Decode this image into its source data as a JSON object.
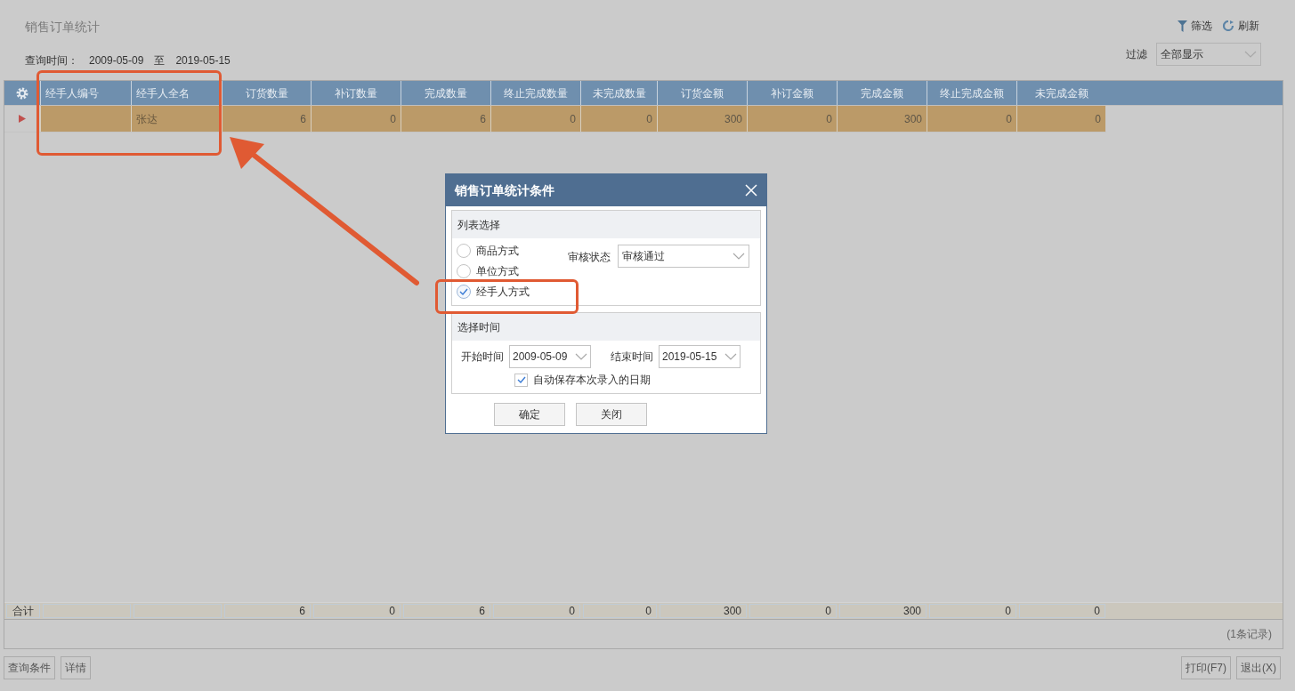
{
  "title": "销售订单统计",
  "query_time": {
    "label": "查询时间：",
    "start": "2009-05-09",
    "to": "至",
    "end": "2019-05-15"
  },
  "toolbar": [
    {
      "kind": "filter",
      "label": "筛选"
    },
    {
      "kind": "refresh",
      "label": "刷新"
    }
  ],
  "filter": {
    "label": "过滤",
    "value": "全部显示"
  },
  "table": {
    "columns": [
      "经手人编号",
      "经手人全名",
      "订货数量",
      "补订数量",
      "完成数量",
      "终止完成数量",
      "未完成数量",
      "订货金额",
      "补订金额",
      "完成金额",
      "终止完成金额",
      "未完成金额"
    ],
    "rows": [
      {
        "selected": true,
        "cells": [
          "",
          "张达",
          "6",
          "0",
          "6",
          "0",
          "0",
          "300",
          "0",
          "300",
          "0",
          "0"
        ]
      }
    ],
    "totals": {
      "label": "合计",
      "cells": [
        "",
        "",
        "6",
        "0",
        "6",
        "0",
        "0",
        "300",
        "0",
        "300",
        "0",
        "0"
      ]
    }
  },
  "record_count": "(1条记录)",
  "buttons_left": [
    "查询条件",
    "详情"
  ],
  "buttons_right": [
    "打印(F7)",
    "退出(X)"
  ],
  "dialog": {
    "title": "销售订单统计条件",
    "list_section": {
      "title": "列表选择",
      "options": [
        {
          "label": "商品方式",
          "selected": false
        },
        {
          "label": "单位方式",
          "selected": false
        },
        {
          "label": "经手人方式",
          "selected": true
        }
      ],
      "audit_label": "审核状态",
      "audit_value": "审核通过"
    },
    "time_section": {
      "title": "选择时间",
      "start_label": "开始时间",
      "start_value": "2009-05-09",
      "end_label": "结束时间",
      "end_value": "2019-05-15",
      "autosave": {
        "label": "自动保存本次录入的日期",
        "checked": true
      }
    },
    "buttons": [
      "确定",
      "关闭"
    ]
  }
}
